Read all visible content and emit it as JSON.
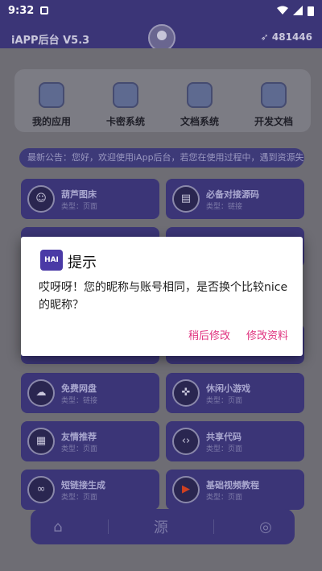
{
  "status": {
    "time": "9:32"
  },
  "header": {
    "title": "iAPP后台 V5.3",
    "count": "481446"
  },
  "quick": [
    {
      "label": "我的应用",
      "icon": "cube-icon"
    },
    {
      "label": "卡密系统",
      "icon": "table-icon"
    },
    {
      "label": "文档系统",
      "icon": "grid-icon"
    },
    {
      "label": "开发文档",
      "icon": "chart-icon"
    }
  ],
  "notice": "最新公告：您好，欢迎使用iApp后台，若您在使用过程中，遇到资源失效",
  "cards": [
    {
      "name": "葫芦图床",
      "type": "类型：页面"
    },
    {
      "name": "必备对接源码",
      "type": "类型：链接"
    },
    {
      "name": "免费网盘",
      "type": "类型：链接"
    },
    {
      "name": "休闲小游戏",
      "type": "类型：页面"
    },
    {
      "name": "友情推荐",
      "type": "类型：页面"
    },
    {
      "name": "共享代码",
      "type": "类型：页面"
    },
    {
      "name": "短链接生成",
      "type": "类型：页面"
    },
    {
      "name": "基础视频教程",
      "type": "类型：页面"
    }
  ],
  "bottomnav": {
    "center": "源"
  },
  "dialog": {
    "icon_text": "HAI",
    "title": "提示",
    "message": "哎呀呀！您的昵称与账号相同，是否换个比较nice的昵称？",
    "later": "稍后修改",
    "edit": "修改资料"
  },
  "colors": {
    "primary": "#3b3577",
    "accent": "#e0337f"
  }
}
